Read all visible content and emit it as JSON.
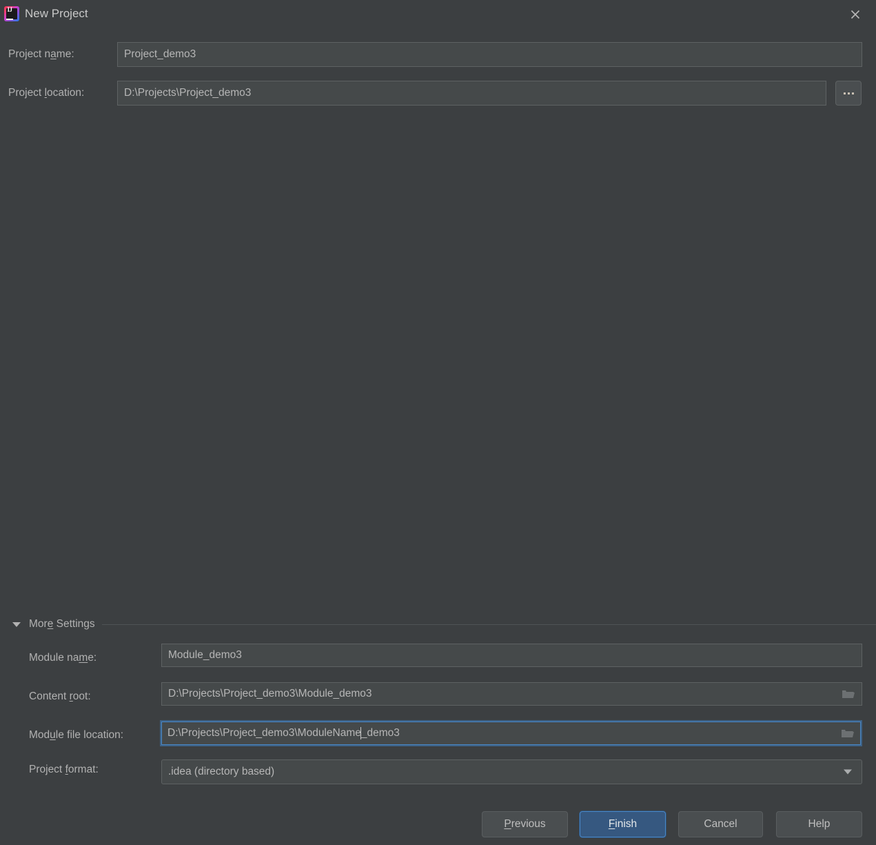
{
  "window": {
    "title": "New Project",
    "app_icon": "intellij-idea-icon",
    "close_icon": "close-icon"
  },
  "form": {
    "project_name": {
      "label_before": "Project n",
      "label_mnemonic": "a",
      "label_after": "me:",
      "value": "Project_demo3"
    },
    "project_location": {
      "label_before": "Project ",
      "label_mnemonic": "l",
      "label_after": "ocation:",
      "value": "D:\\Projects\\Project_demo3",
      "browse_label": "..."
    }
  },
  "more_settings": {
    "label_before": "Mor",
    "label_mnemonic": "e",
    "label_after": " Settings",
    "expanded": true,
    "arrow_icon": "chevron-down-icon",
    "module_name": {
      "label_before": "Module na",
      "label_mnemonic": "m",
      "label_after": "e:",
      "value": "Module_demo3"
    },
    "content_root": {
      "label_before": "Content ",
      "label_mnemonic": "r",
      "label_after": "oot:",
      "value": "D:\\Projects\\Project_demo3\\Module_demo3",
      "browse_icon": "folder-icon"
    },
    "module_file_location": {
      "label_before": "Mod",
      "label_mnemonic": "u",
      "label_after": "le file location:",
      "value_before_caret": "D:\\Projects\\Project_demo3\\ModuleName",
      "value_after_caret": "_demo3",
      "focused": true,
      "browse_icon": "folder-icon"
    },
    "project_format": {
      "label_before": "Project ",
      "label_mnemonic": "f",
      "label_after": "ormat:",
      "value": ".idea (directory based)",
      "arrow_icon": "chevron-down-icon"
    }
  },
  "buttons": {
    "previous": {
      "mnemonic": "P",
      "rest": "revious"
    },
    "finish": {
      "mnemonic": "F",
      "rest": "inish"
    },
    "cancel": {
      "label": "Cancel"
    },
    "help": {
      "label": "Help"
    }
  },
  "colors": {
    "background": "#3c3f41",
    "field_background": "#45494a",
    "field_border": "#5e6263",
    "focus_border": "#4a88c7",
    "primary_button": "#365880",
    "text": "#b2b2b2"
  }
}
